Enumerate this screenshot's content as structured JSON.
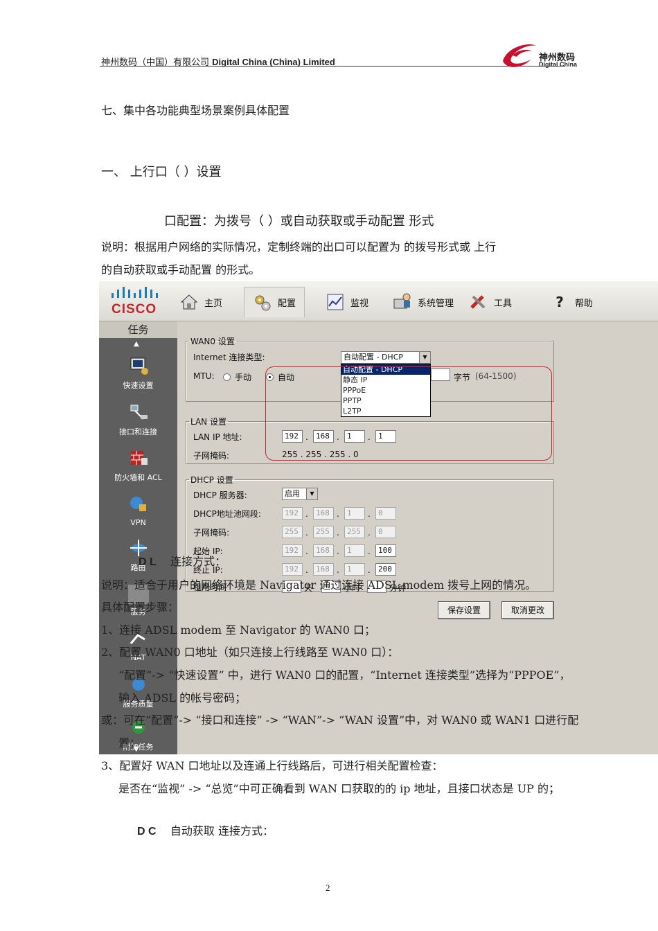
{
  "header": {
    "company_cn": "神州数码（中国）有限公司",
    "company_en": "Digital China  (China)  Limited",
    "logo_cn": "神州数码",
    "logo_en": "Digital China"
  },
  "doc": {
    "section7": "七、集中各功能典型场景案例具体配置",
    "section1": "一、 上行口（        ）设置",
    "subtitle": "口配置：为拨号（            ）或自动获取或手动配置      形式",
    "desc1": "说明：根据用户网络的实际情况，定制终端的出口可以配置为          的拨号形式或        上行",
    "desc2": "的自动获取或手动配置      的形式。",
    "dl_title": "D L",
    "dl_rest": "连接方式：",
    "note": "说明：适合于用户的网络环境是 Navigator 通过连接 ADSL modem 拨号上网的情况。",
    "steps_title": "具体配置步骤：",
    "step1": "1、连接 ADSL modem 至 Navigator 的 WAN0 口；",
    "step2": "2、配置 WAN0 口地址（如只连接上行线路至 WAN0 口）：",
    "step2a": "“配置”-> “快速设置” 中，进行 WAN0 口的配置，“Internet 连接类型”选择为“PPPOE”，",
    "step2b": "输入 ADSL 的帐号密码；",
    "step2c": "或：可在“配置”-> “接口和连接” -> “WAN”-> “WAN 设置”中，对 WAN0 或 WAN1 口进行配",
    "step2d": "置；",
    "step3": "3、配置好 WAN 口地址以及连通上行线路后，可进行相关配置检查：",
    "step3a": "是否在“监视” -> “总览”中可正确看到 WAN 口获取的的 ip 地址，且接口状态是 UP 的；",
    "dc_title": "D C",
    "dc_rest": "自动获取      连接方式：",
    "page": "2"
  },
  "ui": {
    "brand": "CISCO",
    "nav": [
      "主页",
      "配置",
      "监视",
      "系统管理",
      "工具",
      "帮助"
    ],
    "sidebar_title": "任务",
    "sidebar": [
      "快速设置",
      "接口和连接",
      "防火墙和 ACL",
      "VPN",
      "路由",
      "服务",
      "NAT",
      "服务质量",
      "附加任务"
    ],
    "wan": {
      "legend": "WAN0 设置",
      "type_label": "Internet 连接类型:",
      "type_value": "自动配置 - DHCP",
      "mtu_label": "MTU:",
      "manual": "手动",
      "auto": "自动",
      "unit": "字节",
      "range": "(64-1500)",
      "options": [
        "自动配置 - DHCP",
        "静态 IP",
        "PPPoE",
        "PPTP",
        "L2TP"
      ]
    },
    "lan": {
      "legend": "LAN 设置",
      "ip_label": "LAN IP 地址:",
      "ip": [
        "192",
        "168",
        "1",
        "1"
      ],
      "mask_label": "子网掩码:",
      "mask": "255 . 255 . 255 . 0"
    },
    "dhcp": {
      "legend": "DHCP 设置",
      "server_label": "DHCP 服务器:",
      "server_value": "启用",
      "pool_label": "DHCP地址池网段:",
      "pool": [
        "192",
        "168",
        "1",
        "0"
      ],
      "mask_label": "子网掩码:",
      "mask": [
        "255",
        "255",
        "255",
        "0"
      ],
      "start_label": "起始 IP:",
      "start": [
        "192",
        "168",
        "1",
        "100"
      ],
      "end_label": "终止 IP:",
      "end": [
        "192",
        "168",
        "1",
        "200"
      ],
      "lease_label": "租用时间",
      "lease_days": "天",
      "lease_hours": "小时",
      "lease_min": "分钟"
    },
    "save": "保存设置",
    "cancel": "取消更改"
  }
}
